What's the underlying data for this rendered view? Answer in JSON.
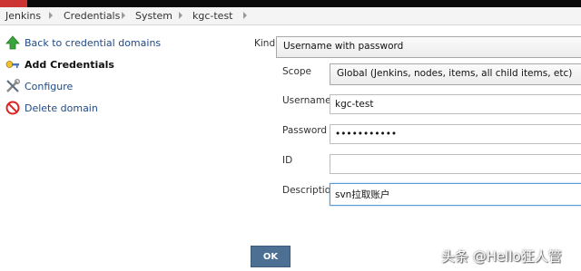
{
  "breadcrumb": [
    "Jenkins",
    "Credentials",
    "System",
    "kgc-test"
  ],
  "sidebar": {
    "items": [
      {
        "label": "Back to credential domains",
        "icon": "up-arrow-icon"
      },
      {
        "label": "Add Credentials",
        "icon": "key-icon",
        "active": true
      },
      {
        "label": "Configure",
        "icon": "tools-icon"
      },
      {
        "label": "Delete domain",
        "icon": "no-entry-icon"
      }
    ]
  },
  "form": {
    "kind_label": "Kind",
    "kind_value": "Username with password",
    "scope_label": "Scope",
    "scope_value": "Global (Jenkins, nodes, items, all child items, etc)",
    "username_label": "Username",
    "username_value": "kgc-test",
    "password_label": "Password",
    "password_value": "•••••••••••",
    "id_label": "ID",
    "id_value": "",
    "description_label": "Description",
    "description_value": "svn拉取账户",
    "ok_label": "OK"
  },
  "watermark": "头条 @Hello狂人管"
}
